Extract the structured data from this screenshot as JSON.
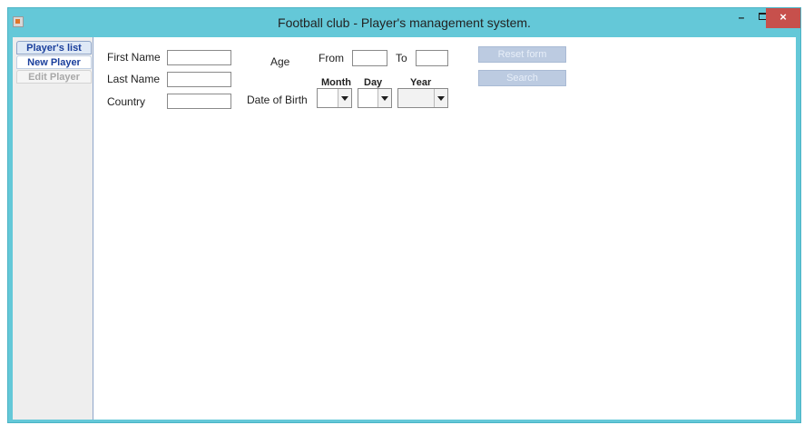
{
  "window": {
    "title": "Football club - Player's management system.",
    "minimize_glyph": "–",
    "close_glyph": "×"
  },
  "tabs": {
    "players_list": "Player's list",
    "new_player": "New Player",
    "edit_player": "Edit Player"
  },
  "form": {
    "first_name_label": "First Name",
    "last_name_label": "Last Name",
    "country_label": "Country",
    "age_label": "Age",
    "from_label": "From",
    "to_label": "To",
    "date_of_birth_label": "Date of Birth",
    "month_label": "Month",
    "day_label": "Day",
    "year_label": "Year",
    "first_name_value": "",
    "last_name_value": "",
    "country_value": "",
    "age_from_value": "",
    "age_to_value": ""
  },
  "buttons": {
    "reset_form": "Reset form",
    "search": "Search"
  },
  "colors": {
    "titlebar": "#64c8d8",
    "close_button": "#c7504c",
    "disabled_button": "#bccbe1",
    "tab_text": "#1a3f9c"
  },
  "icons": {
    "app": "java-icon",
    "minimize": "minimize-icon",
    "maximize": "maximize-icon",
    "close": "close-icon"
  }
}
